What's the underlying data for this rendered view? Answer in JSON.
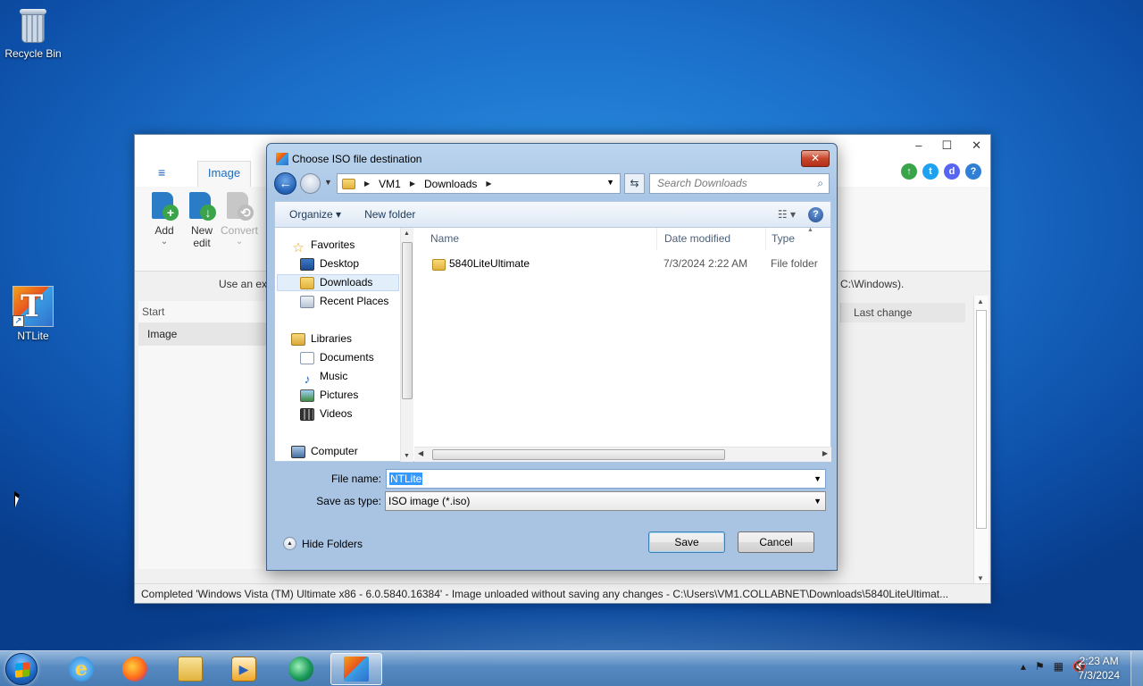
{
  "desktop": {
    "icons": [
      {
        "label": "Recycle Bin",
        "icon": "recycle-bin-icon"
      },
      {
        "label": "NTLite",
        "icon": "ntlite-icon"
      }
    ]
  },
  "ntlite": {
    "menu_icon": "≡",
    "tab_image": "Image",
    "tools": [
      {
        "label": "Add",
        "sub": "⌄",
        "icon": "add-image-icon",
        "enabled": true
      },
      {
        "label": "New edit",
        "icon": "new-edit-icon",
        "enabled": true
      },
      {
        "label": "Convert",
        "sub": "⌄",
        "icon": "convert-icon",
        "enabled": false
      }
    ],
    "info_text": "Use an exi",
    "info_text_right": "C:\\Windows).",
    "left_pane": {
      "header": "Start",
      "item": "Image"
    },
    "grid_col": "Last change",
    "status": "Completed  'Windows Vista (TM) Ultimate x86 - 6.0.5840.16384' - Image unloaded without saving any changes - C:\\Users\\VM1.COLLABNET\\Downloads\\5840LiteUltimat...",
    "window_controls": {
      "minimize": "–",
      "maximize": "☐",
      "close": "✕"
    }
  },
  "dialog": {
    "title": "Choose ISO file destination",
    "close": "✕",
    "breadcrumb": [
      "VM1",
      "Downloads"
    ],
    "search_placeholder": "Search Downloads",
    "organize": "Organize ▾",
    "new_folder": "New folder",
    "nav": {
      "favorites": "Favorites",
      "desktop": "Desktop",
      "downloads": "Downloads",
      "recent": "Recent Places",
      "libraries": "Libraries",
      "documents": "Documents",
      "music": "Music",
      "pictures": "Pictures",
      "videos": "Videos",
      "computer": "Computer"
    },
    "columns": {
      "name": "Name",
      "date": "Date modified",
      "type": "Type"
    },
    "files": [
      {
        "name": "5840LiteUltimate",
        "date": "7/3/2024 2:22 AM",
        "type": "File folder"
      }
    ],
    "file_name_label": "File name:",
    "file_name_value": "NTLite",
    "save_type_label": "Save as type:",
    "save_type_value": "ISO image (*.iso)",
    "hide_folders": "Hide Folders",
    "save": "Save",
    "cancel": "Cancel"
  },
  "taskbar": {
    "apps": [
      "internet-explorer-icon",
      "firefox-icon",
      "file-explorer-icon",
      "media-player-icon",
      "disk-utility-icon",
      "ntlite-icon"
    ],
    "tray": {
      "show_hidden": "▴",
      "flag": "⚑",
      "network": "▦",
      "volume": "🔇"
    },
    "time": "2:23 AM",
    "date": "7/3/2024"
  },
  "colors": {
    "accent": "#1a6ec2",
    "dialog_frame": "#a9c3e2",
    "selection": "#3399ff"
  }
}
